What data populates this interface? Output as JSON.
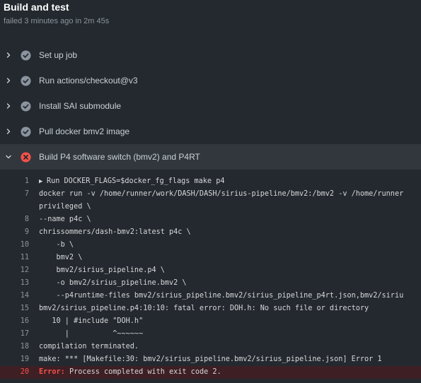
{
  "header": {
    "title": "Build and test",
    "subtitle": "failed 3 minutes ago in 2m 45s"
  },
  "colors": {
    "success_icon": "#8b949e",
    "failure_icon": "#f85149",
    "error_line_bg": "#3d1f24"
  },
  "steps": [
    {
      "label": "Set up job",
      "status": "success",
      "expanded": false,
      "icon": "check-circle-icon"
    },
    {
      "label": "Run actions/checkout@v3",
      "status": "success",
      "expanded": false,
      "icon": "check-circle-icon"
    },
    {
      "label": "Install SAI submodule",
      "status": "success",
      "expanded": false,
      "icon": "check-circle-icon"
    },
    {
      "label": "Pull docker bmv2 image",
      "status": "success",
      "expanded": false,
      "icon": "check-circle-icon"
    },
    {
      "label": "Build P4 software switch (bmv2) and P4RT",
      "status": "failure",
      "expanded": true,
      "icon": "x-circle-icon"
    }
  ],
  "log": {
    "lines": [
      {
        "num": "1",
        "text": "Run DOCKER_FLAGS=$docker_fg_flags make p4",
        "collapsible": true
      },
      {
        "num": "7",
        "text": "docker run -v /home/runner/work/DASH/DASH/sirius-pipeline/bmv2:/bmv2 -v /home/runner"
      },
      {
        "num": "",
        "text": "privileged \\"
      },
      {
        "num": "8",
        "text": "--name p4c \\"
      },
      {
        "num": "9",
        "text": "chrissommers/dash-bmv2:latest p4c \\"
      },
      {
        "num": "10",
        "text": "    -b \\"
      },
      {
        "num": "11",
        "text": "    bmv2 \\"
      },
      {
        "num": "12",
        "text": "    bmv2/sirius_pipeline.p4 \\"
      },
      {
        "num": "13",
        "text": "    -o bmv2/sirius_pipeline.bmv2 \\"
      },
      {
        "num": "14",
        "text": "    --p4runtime-files bmv2/sirius_pipeline.bmv2/sirius_pipeline_p4rt.json,bmv2/siriu"
      },
      {
        "num": "15",
        "text": "bmv2/sirius_pipeline.p4:10:10: fatal error: DOH.h: No such file or directory"
      },
      {
        "num": "16",
        "text": "   10 | #include \"DOH.h\""
      },
      {
        "num": "17",
        "text": "      |          ^~~~~~~"
      },
      {
        "num": "18",
        "text": "compilation terminated."
      },
      {
        "num": "19",
        "text": "make: *** [Makefile:30: bmv2/sirius_pipeline.bmv2/sirius_pipeline.json] Error 1"
      },
      {
        "num": "20",
        "prefix": "Error:",
        "text": " Process completed with exit code 2.",
        "error": true
      }
    ]
  }
}
